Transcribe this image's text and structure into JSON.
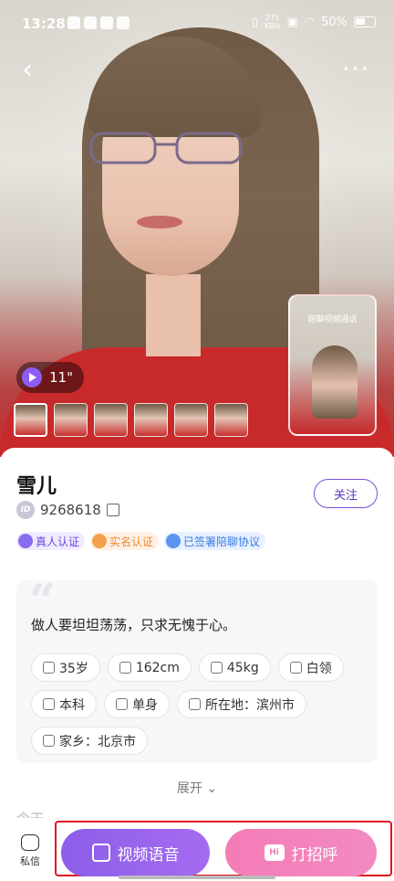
{
  "status_bar": {
    "time": "13:28",
    "net_speed_value": "275",
    "net_speed_unit": "KB/s",
    "battery": "50%"
  },
  "hero": {
    "video_duration": "11\"",
    "thumbnail_count": 6,
    "preview_label": "跑聊视频通话"
  },
  "profile": {
    "name": "雪儿",
    "id": "9268618",
    "id_badge": "ID",
    "follow_label": "关注",
    "tags": [
      "真人认证",
      "实名认证",
      "已签署陪聊协议"
    ],
    "bio": "做人要坦坦荡荡，只求无愧于心。",
    "attributes": [
      "35岁",
      "162cm",
      "45kg",
      "白领",
      "本科",
      "单身",
      "所在地：滨州市",
      "家乡：北京市"
    ],
    "expand_label": "展开",
    "section_today": "今天"
  },
  "bottom_bar": {
    "message_label": "私信",
    "video_voice_label": "视频语音",
    "greet_label": "打招呼",
    "greet_icon_text": "Hi"
  }
}
